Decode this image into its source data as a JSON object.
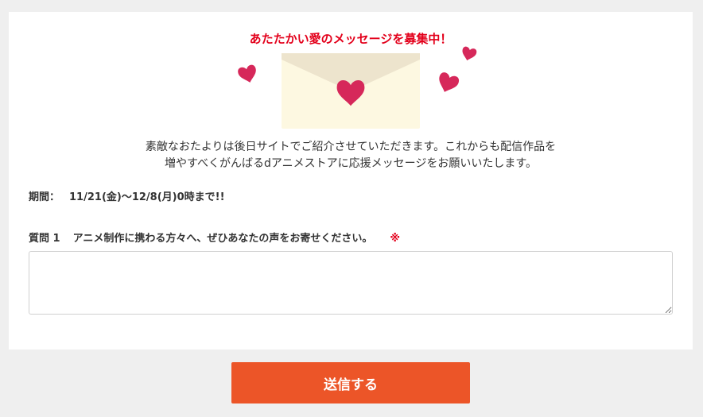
{
  "form": {
    "headline": "あたたかい愛のメッセージを募集中！",
    "description": [
      "素敵なおたよりは後日サイトでご紹介させていただきます。これからも配信作品を",
      "増やすべくがんばるdアニメストアに応援メッセージをお願いいたします。"
    ],
    "period_label": "期間：",
    "period_value": "11/21(金)〜12/8(月)0時まで!!",
    "question_number": "質問 1",
    "question_text": "アニメ制作に携わる方々へ、ぜひあなたの声をお寄せください。",
    "required_mark": "※",
    "answer_value": "",
    "submit_label": "送信する"
  },
  "colors": {
    "accent_red": "#e3001b",
    "heart": "#d6285a",
    "envelope_body": "#fdf8e1",
    "envelope_flap": "#ede4cd",
    "submit_button": "#ec5528",
    "page_background": "#efefef"
  },
  "icons": {
    "envelope": "envelope-icon",
    "heart": "heart-icon"
  }
}
